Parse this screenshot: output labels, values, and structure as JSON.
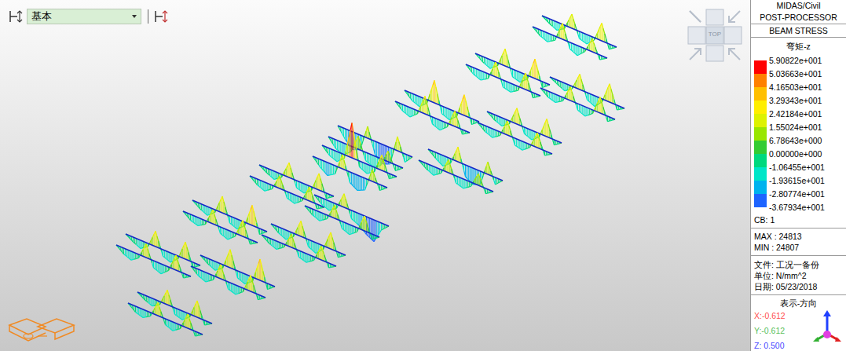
{
  "toolbar": {
    "view_preset": "基本"
  },
  "view_cube": {
    "label": "TOP"
  },
  "legend": {
    "app": "MIDAS/Civil",
    "module": "POST-PROCESSOR",
    "result": "BEAM STRESS",
    "component": "弯矩-z",
    "labels": [
      "5.90822e+001",
      "5.03663e+001",
      "4.16503e+001",
      "3.29343e+001",
      "2.42184e+001",
      "1.55024e+001",
      "6.78643e+000",
      "0.00000e+000",
      "-1.06455e+001",
      "-1.93615e+001",
      "-2.80774e+001",
      "-3.67934e+001"
    ],
    "colors": [
      "#ff0000",
      "#ff8000",
      "#ffbf00",
      "#ffee00",
      "#ddf200",
      "#99e600",
      "#33cc33",
      "#00d97e",
      "#00e6c8",
      "#00b3ee",
      "#1e64ff"
    ],
    "combination": "CB: 1",
    "max": "MAX : 24813",
    "min": "MIN : 24807",
    "file": "文件: 工况一备份",
    "unit": "单位: N/mm^2",
    "date": "日期: 05/23/2018",
    "direction_title": "表示-方向",
    "direction": [
      {
        "label": "X:-0.612",
        "color": "#ff5050"
      },
      {
        "label": "Y:-0.612",
        "color": "#5cbf5c"
      },
      {
        "label": "Z: 0.500",
        "color": "#4a4aff"
      }
    ]
  },
  "model_view": {
    "groups": [
      {
        "beams": [
          [
            0,
            -8,
            -14,
            -6,
            24,
            -12,
            -16,
            -4,
            30,
            -9,
            0
          ],
          [
            0,
            -10,
            -15,
            -7,
            27,
            -11,
            -17,
            -5,
            22,
            -8,
            0
          ]
        ]
      },
      {
        "beams": [
          [
            0,
            -9,
            -15,
            -5,
            29,
            -13,
            -17,
            -6,
            33,
            -10,
            0
          ],
          [
            0,
            -11,
            -16,
            -8,
            25,
            -12,
            -15,
            -7,
            28,
            -9,
            0
          ]
        ]
      },
      {
        "beams": [
          [
            0,
            -7,
            -13,
            -4,
            26,
            -12,
            -18,
            -5,
            31,
            -8,
            0
          ],
          [
            0,
            -10,
            -14,
            -6,
            23,
            -11,
            -16,
            -6,
            27,
            -9,
            0
          ]
        ]
      },
      {
        "beams": [
          [
            0,
            -12,
            -17,
            -6,
            38,
            -13,
            -18,
            -7,
            35,
            -10,
            0
          ],
          [
            0,
            -11,
            -16,
            -5,
            30,
            -12,
            -17,
            -6,
            26,
            -8,
            0
          ]
        ]
      },
      {
        "beams": [
          [
            0,
            -9,
            -14,
            -5,
            27,
            -11,
            -16,
            -6,
            30,
            -9,
            0
          ],
          [
            0,
            -10,
            -15,
            -6,
            24,
            -12,
            -15,
            -5,
            25,
            -8,
            0
          ]
        ]
      },
      {
        "beams": [
          [
            0,
            -18,
            -30,
            -25,
            20,
            -22,
            -33,
            -28,
            24,
            -14,
            0
          ],
          [
            0,
            -15,
            -20,
            -10,
            22,
            -14,
            -19,
            -12,
            18,
            -10,
            0
          ]
        ]
      },
      {
        "beams": [
          [
            0,
            -10,
            -18,
            -8,
            25,
            -20,
            -28,
            -22,
            21,
            -12,
            0
          ],
          [
            0,
            -9,
            -15,
            -6,
            22,
            -12,
            -16,
            -7,
            20,
            -9,
            0
          ]
        ]
      },
      {
        "beams": [
          [
            0,
            -8,
            -14,
            -5,
            25,
            -12,
            -16,
            -6,
            28,
            -9,
            0
          ],
          [
            0,
            -10,
            -15,
            -6,
            21,
            -11,
            -15,
            -5,
            24,
            -8,
            0
          ]
        ]
      },
      {
        "beams": [
          [
            0,
            -12,
            -17,
            -6,
            59.08,
            -10,
            -16,
            -8,
            26,
            -9,
            0
          ],
          [
            0,
            -13,
            -22,
            -14,
            24,
            -18,
            -26,
            -20,
            20,
            -10,
            0
          ]
        ]
      },
      {
        "beams": [
          [
            0,
            -9,
            -15,
            -5,
            28,
            -12,
            -17,
            -6,
            34,
            -10,
            0
          ],
          [
            0,
            -10,
            -14,
            -6,
            24,
            -11,
            -16,
            -5,
            27,
            -8,
            0
          ]
        ]
      },
      {
        "beams": [
          [
            0,
            -11,
            -16,
            -7,
            23,
            -14,
            -20,
            -30,
            -36.79,
            -12,
            0
          ],
          [
            0,
            -10,
            -15,
            -6,
            22,
            -12,
            -17,
            -7,
            25,
            -9,
            0
          ]
        ]
      },
      {
        "beams": [
          [
            0,
            -10,
            -16,
            -6,
            26,
            -12,
            -18,
            -6,
            28,
            -9,
            0
          ],
          [
            0,
            -9,
            -14,
            -5,
            22,
            -11,
            -15,
            -6,
            23,
            -8,
            0
          ]
        ]
      },
      {
        "beams": [
          [
            0,
            -8,
            -14,
            -5,
            26,
            -11,
            -16,
            -5,
            29,
            -9,
            0
          ],
          [
            0,
            -10,
            -15,
            -6,
            23,
            -12,
            -17,
            -6,
            25,
            -8,
            0
          ]
        ]
      },
      {
        "beams": [
          [
            0,
            -9,
            -15,
            -6,
            31,
            -12,
            -17,
            -7,
            36,
            -10,
            0
          ],
          [
            0,
            -11,
            -16,
            -7,
            24,
            -12,
            -16,
            -6,
            27,
            -9,
            0
          ]
        ]
      },
      {
        "beams": [
          [
            0,
            -8,
            -13,
            -5,
            25,
            -11,
            -15,
            -5,
            28,
            -8,
            0
          ],
          [
            0,
            -10,
            -14,
            -6,
            22,
            -10,
            -15,
            -6,
            24,
            -8,
            0
          ]
        ]
      }
    ]
  }
}
